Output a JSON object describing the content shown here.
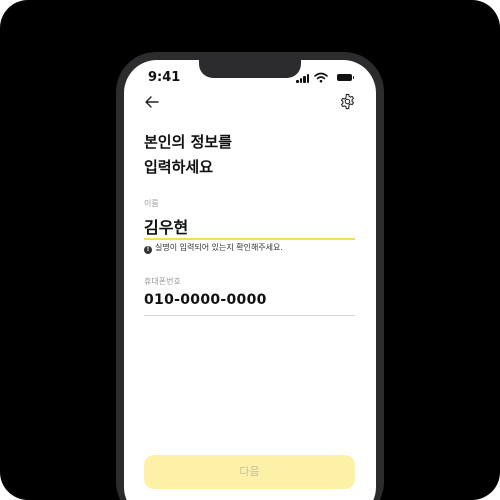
{
  "status_bar": {
    "time": "9:41",
    "icons": [
      "signal-icon",
      "wifi-icon",
      "battery-icon"
    ]
  },
  "header": {
    "back_icon": "arrow-left-icon",
    "settings_icon": "gear-icon"
  },
  "title": {
    "line1": "본인의 정보를",
    "line2": "입력하세요"
  },
  "form": {
    "name": {
      "label": "이름",
      "value": "김우현",
      "warning": "실명이 입력되어 있는지 확인해주세요.",
      "warning_icon": "alert-circle-icon"
    },
    "phone": {
      "label": "휴대폰번호",
      "value": "010-0000-0000"
    }
  },
  "next_button": {
    "label": "다음"
  },
  "colors": {
    "accent": "#f5dd57",
    "button_disabled_bg": "#fcf1a7",
    "background": "#000000"
  }
}
